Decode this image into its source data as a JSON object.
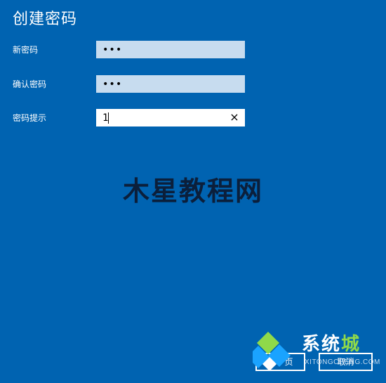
{
  "dialog": {
    "title": "创建密码"
  },
  "form": {
    "new_password": {
      "label": "新密码",
      "value": "•••"
    },
    "confirm_password": {
      "label": "确认密码",
      "value": "•••"
    },
    "hint": {
      "label": "密码提示",
      "value": "1",
      "clear_icon": "×"
    }
  },
  "buttons": {
    "next": "下一页",
    "cancel": "取消"
  },
  "watermarks": {
    "center": "木星教程网",
    "logo_main": "系统",
    "logo_accent": "城",
    "logo_sub": "XITONGCHENG.COM"
  },
  "colors": {
    "background": "#0063b1",
    "field_fill": "#c7dcef",
    "accent_green": "#8fd94a",
    "accent_blue": "#1aa3ff"
  }
}
